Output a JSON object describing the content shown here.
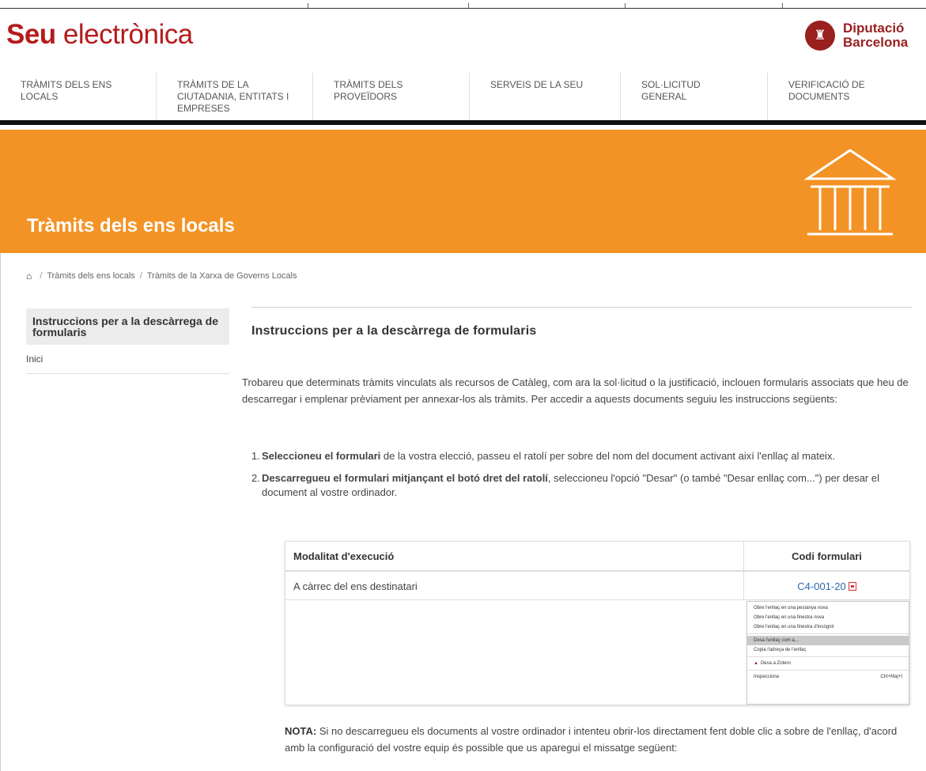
{
  "header": {
    "logo_bold": "Seu",
    "logo_rest": " electrònica",
    "org_line1": "Diputació",
    "org_line2": "Barcelona",
    "org_emblem": "emblem-icon"
  },
  "nav": {
    "items": [
      {
        "label": "TRÀMITS DELS ENS LOCALS"
      },
      {
        "label": "TRÀMITS DE LA CIUTADANIA, ENTITATS I EMPRESES"
      },
      {
        "label": "TRÀMITS DELS PROVEÏDORS"
      },
      {
        "label": "SERVEIS DE LA SEU"
      },
      {
        "label": "SOL·LICITUD GENERAL"
      },
      {
        "label": "VERIFICACIÓ DE DOCUMENTS"
      }
    ]
  },
  "banner": {
    "title": "Tràmits dels ens locals",
    "icon": "building-columns-icon",
    "color": "#f39325"
  },
  "breadcrumb": {
    "home_icon": "home-icon",
    "items": [
      "Tràmits dels ens locals",
      "Tràmits de la Xarxa de Governs Locals"
    ]
  },
  "sidebar": {
    "title": "Instruccions per a la descàrrega de formularis",
    "items": [
      "Inici"
    ]
  },
  "main": {
    "title": "Instruccions per a la descàrrega de formularis",
    "intro": "Trobareu que determinats tràmits vinculats als recursos de Catàleg, com ara la sol·licitud o la justificació, inclouen formularis associats que heu de descarregar i emplenar prèviament per annexar-los als tràmits. Per accedir a aquests documents seguiu les instruccions següents:",
    "steps": [
      {
        "num": "1.",
        "bold": "Seleccioneu el formulari",
        "rest": " de la vostra elecció, passeu el ratolí per sobre del nom del document activant així l'enllaç al mateix."
      },
      {
        "num": "2.",
        "bold": "Descarregueu el formulari mitjançant el botó dret del ratolí",
        "rest": ", seleccioneu l'opció \"Desar\" (o també \"Desar enllaç com...\") per desar el document al vostre ordinador."
      }
    ],
    "table": {
      "headers": [
        "Modalitat d'execució",
        "Codi formulari"
      ],
      "rows": [
        {
          "modalitat": "A càrrec del ens destinatari",
          "codi": "C4-001-20"
        }
      ]
    },
    "context_menu": {
      "items": [
        {
          "label": "Obre l'enllaç en una pestanya nova"
        },
        {
          "label": "Obre l'enllaç en una finestra nova"
        },
        {
          "label": "Obre l'enllaç en una finestra d'incògnit"
        },
        {
          "label": "Desa l'enllaç com a..."
        },
        {
          "label": "Copia l'adreça de l'enllaç"
        },
        {
          "label": "Desa a Zotero"
        },
        {
          "label": "Inspecciona",
          "shortcut": "Ctrl+Maj+I"
        }
      ]
    },
    "nota_label": "NOTA:",
    "nota_text": " Si no descarregueu els documents al vostre ordinador i intenteu obrir-los directament fent doble clic a sobre de l'enllaç, d'acord amb la configuració del vostre equip és possible que us aparegui el missatge següent:"
  }
}
